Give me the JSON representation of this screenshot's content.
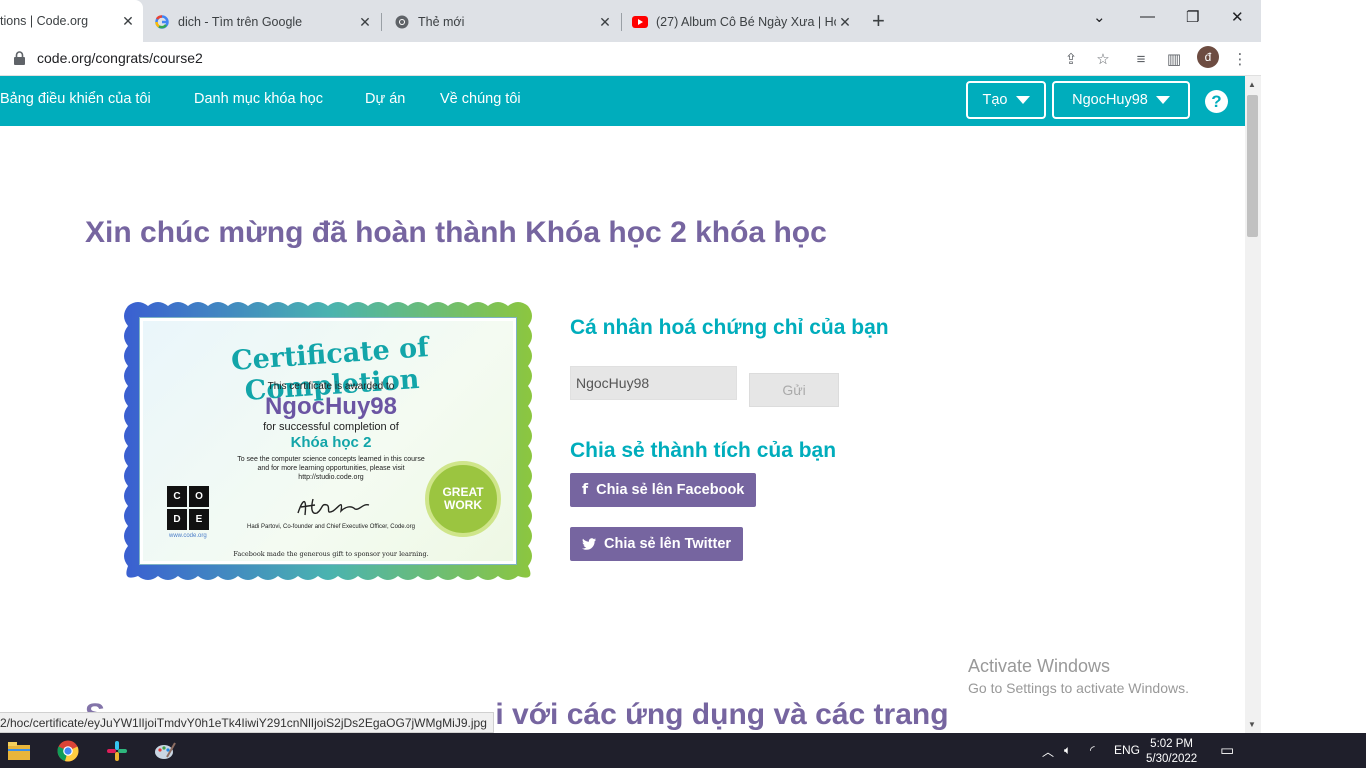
{
  "browser": {
    "tabs": [
      {
        "title": "tions | Code.org",
        "icon": "code-org-icon",
        "active": true
      },
      {
        "title": "dich - Tìm trên Google",
        "icon": "google-icon",
        "active": false
      },
      {
        "title": "Thẻ mới",
        "icon": "chrome-icon",
        "active": false
      },
      {
        "title": "(27) Album Cô Bé Ngày Xưa | Ho",
        "icon": "youtube-icon",
        "active": false
      }
    ],
    "url": "code.org/congrats/course2",
    "avatar_letter": "đ"
  },
  "nav": {
    "links": [
      "Bảng điều khiển của tôi",
      "Danh mục khóa học",
      "Dự án",
      "Về chúng tôi"
    ],
    "create_label": "Tạo",
    "user_label": "NgocHuy98",
    "help_label": "?"
  },
  "page": {
    "title": "Xin chúc mừng đã hoàn thành Khóa học 2 khóa học",
    "personalize_heading": "Cá nhân hoá chứng chỉ của bạn",
    "name_value": "NgocHuy98",
    "send_label": "Gửi",
    "share_heading": "Chia sẻ thành tích của bạn",
    "facebook_label": "Chia sẻ lên Facebook",
    "twitter_label": "Chia sẻ lên Twitter",
    "bottom_title": "i với các ứng dụng và các trang"
  },
  "certificate": {
    "heading": "Certificate of Completion",
    "awarded_text": "This certificate is awarded to",
    "name": "NgocHuy98",
    "completion_text": "for successful completion of",
    "course": "Khóa học 2",
    "info_line1": "To see the computer science concepts learned in this course",
    "info_line2": "and for more learning opportunities, please visit",
    "info_line3": "http://studio.code.org",
    "signer": "Hadi Partovi, Co-founder and Chief Executive Officer, Code.org",
    "sponsor": "Facebook made the generous gift to sponsor your learning.",
    "logo_letters": [
      "C",
      "O",
      "D",
      "E"
    ],
    "seal_line1": "GREAT",
    "seal_line2": "WORK",
    "website": "www.code.org"
  },
  "overlay": {
    "activate_title": "Activate Windows",
    "activate_sub": "Go to Settings to activate Windows.",
    "status_url": "2/hoc/certificate/eyJuYW1lIjoiTmdvY0h1eTk4IiwiY291cnNlIjoiS2jDs2EgaOG7jWMgMiJ9.jpg"
  },
  "taskbar": {
    "lang": "ENG",
    "time": "5:02 PM",
    "date": "5/30/2022"
  },
  "colors": {
    "nav_bg": "#00adbc",
    "accent_purple": "#7665a0"
  }
}
